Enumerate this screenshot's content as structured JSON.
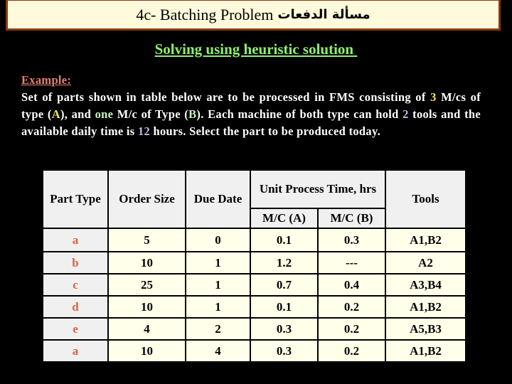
{
  "title": {
    "english": "4c- Batching Problem",
    "arabic": "مسألة الدفعات"
  },
  "subtitle": "Solving using heuristic solution ",
  "example": {
    "label": "Example:",
    "segments": [
      {
        "text": "Set of parts shown in table below are to be processed in FMS consisting of ",
        "style": "normal"
      },
      {
        "text": "3",
        "style": "yellow"
      },
      {
        "text": " M/cs of type (",
        "style": "normal"
      },
      {
        "text": "A",
        "style": "yellow"
      },
      {
        "text": "), and ",
        "style": "normal"
      },
      {
        "text": "one",
        "style": "green"
      },
      {
        "text": " M/c of Type (",
        "style": "normal"
      },
      {
        "text": "B",
        "style": "green"
      },
      {
        "text": "). Each machine of both type can hold ",
        "style": "normal"
      },
      {
        "text": "2",
        "style": "blue"
      },
      {
        "text": " tools and the available daily time is ",
        "style": "normal"
      },
      {
        "text": "12",
        "style": "blue"
      },
      {
        "text": " hours. Select the part to be produced today.",
        "style": "normal"
      }
    ]
  },
  "table": {
    "headers": {
      "part_type": "Part Type",
      "order_size": "Order Size",
      "due_date": "Due Date",
      "unit_process_time": "Unit Process Time, hrs",
      "mc_a": "M/C (A)",
      "mc_b": "M/C (B)",
      "tools": "Tools"
    },
    "rows": [
      {
        "part": "a",
        "order_size": "5",
        "due_date": "0",
        "mc_a": "0.1",
        "mc_b": "0.3",
        "tools": "A1,B2"
      },
      {
        "part": "b",
        "order_size": "10",
        "due_date": "1",
        "mc_a": "1.2",
        "mc_b": "---",
        "tools": "A2"
      },
      {
        "part": "c",
        "order_size": "25",
        "due_date": "1",
        "mc_a": "0.7",
        "mc_b": "0.4",
        "tools": "A3,B4"
      },
      {
        "part": "d",
        "order_size": "10",
        "due_date": "1",
        "mc_a": "0.1",
        "mc_b": "0.2",
        "tools": "A1,B2"
      },
      {
        "part": "e",
        "order_size": "4",
        "due_date": "2",
        "mc_a": "0.3",
        "mc_b": "0.2",
        "tools": "A5,B3"
      },
      {
        "part": "a",
        "order_size": "10",
        "due_date": "4",
        "mc_a": "0.3",
        "mc_b": "0.2",
        "tools": "A1,B2"
      }
    ]
  },
  "colors": {
    "background": "#000000",
    "title_bg": "#fffadc",
    "title_border": "#8b3a10",
    "subtitle": "#8ef06e",
    "example_label": "#e9806e",
    "highlight_yellow": "#f5e64a",
    "highlight_green": "#c8f0c0",
    "highlight_blue": "#b8bce8",
    "part_type_text": "#e0603f",
    "header_bg": "#f0f0f0",
    "cell_bg": "#ffffea"
  }
}
